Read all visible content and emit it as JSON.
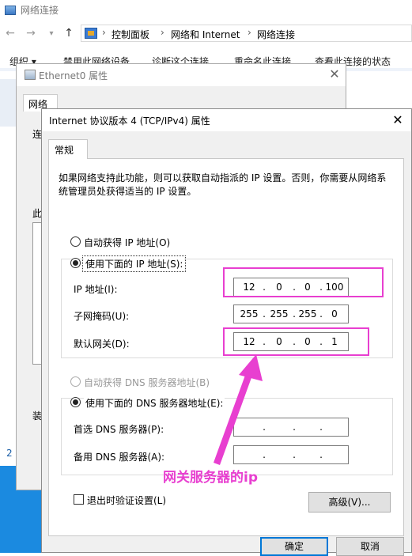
{
  "explorer": {
    "title": "网络连接",
    "breadcrumbs": [
      "控制面板",
      "网络和 Internet",
      "网络连接"
    ],
    "commands": [
      "组织 ▾",
      "禁用此网络设备",
      "诊断这个连接",
      "重命名此连接",
      "查看此连接的状态"
    ],
    "left_digit": "2"
  },
  "ethernet_window": {
    "title": "Ethernet0 属性",
    "tab": "网络",
    "frag_connect": "连",
    "frag_this": "此",
    "frag_install": "装"
  },
  "ipv4_dialog": {
    "title": "Internet 协议版本 4 (TCP/IPv4) 属性",
    "tab_general": "常规",
    "description": "如果网络支持此功能，则可以获取自动指派的 IP 设置。否则，你需要从网络系统管理员处获得适当的 IP 设置。",
    "auto_ip_label": "自动获得 IP 地址(O)",
    "manual_ip_label": "使用下面的 IP 地址(S):",
    "ip_address": {
      "label": "IP 地址(I):",
      "octets": [
        "12",
        "0",
        "0",
        "100"
      ]
    },
    "subnet_mask": {
      "label": "子网掩码(U):",
      "octets": [
        "255",
        "255",
        "255",
        "0"
      ]
    },
    "default_gateway": {
      "label": "默认网关(D):",
      "octets": [
        "12",
        "0",
        "0",
        "1"
      ]
    },
    "auto_dns_label": "自动获得 DNS 服务器地址(B)",
    "manual_dns_label": "使用下面的 DNS 服务器地址(E):",
    "preferred_dns": {
      "label": "首选 DNS 服务器(P):",
      "octets": [
        "",
        "",
        "",
        ""
      ]
    },
    "alternate_dns": {
      "label": "备用 DNS 服务器(A):",
      "octets": [
        "",
        "",
        "",
        ""
      ]
    },
    "validate_on_exit_label": "退出时验证设置(L)",
    "validate_on_exit_checked": false,
    "advanced_button": "高级(V)...",
    "ok_button": "确定",
    "cancel_button": "取消",
    "selected_ip_mode": "manual",
    "selected_dns_mode": "manual"
  },
  "annotation": {
    "text": "网关服务器的ip",
    "color": "#e83fd0"
  }
}
